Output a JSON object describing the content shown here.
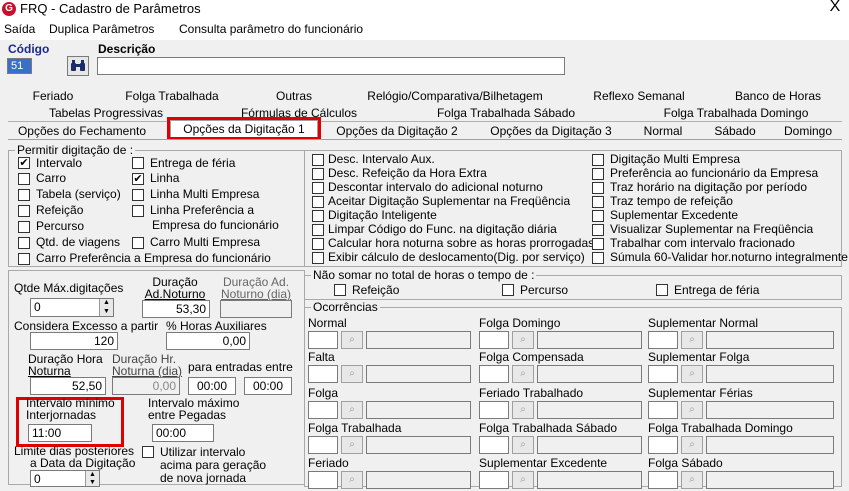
{
  "window": {
    "title": "FRQ - Cadastro de Parâmetros",
    "close_glyph": "X"
  },
  "menu": {
    "items": [
      "Saída",
      "Duplica Parâmetros",
      "Consulta parâmetro do funcionário"
    ]
  },
  "header": {
    "codigo_label": "Código",
    "codigo_value": "51",
    "descricao_label": "Descrição",
    "descricao_value": ""
  },
  "tabs": {
    "row1": [
      "Feriado",
      "Folga Trabalhada",
      "Outras",
      "Relógio/Comparativa/Bilhetagem",
      "Reflexo Semanal",
      "Banco de Horas"
    ],
    "row2": [
      "Tabelas Progressivas",
      "Fórmulas de Cálculos",
      "Folga Trabalhada Sábado",
      "Folga Trabalhada Domingo"
    ],
    "row3": [
      "Opções do Fechamento",
      "Opções da Digitação 1",
      "Opções da Digitação 2",
      "Opções da Digitação 3",
      "Normal",
      "Sábado",
      "Domingo"
    ],
    "active": "Opções da Digitação 1"
  },
  "permitir": {
    "title": "Permitir digitação de :",
    "left": [
      {
        "label": "Intervalo",
        "checked": true
      },
      {
        "label": "Carro",
        "checked": false
      },
      {
        "label": "Tabela (serviço)",
        "checked": false
      },
      {
        "label": "Refeição",
        "checked": false
      },
      {
        "label": "Percurso",
        "checked": false
      },
      {
        "label": "Qtd. de viagens",
        "checked": false
      },
      {
        "label": "Carro Preferência a Empresa do funcionário",
        "checked": false
      }
    ],
    "right": [
      {
        "label": "Entrega de féria",
        "checked": false
      },
      {
        "label": "Linha",
        "checked": true
      },
      {
        "label": "Linha Multi Empresa",
        "checked": false
      },
      {
        "label": "Linha Preferência a",
        "checked": false
      },
      {
        "label": "Empresa do funcionário"
      },
      {
        "label": "Carro Multi Empresa",
        "checked": false
      }
    ]
  },
  "options_mid": [
    "Desc. Intervalo Aux.",
    "Desc. Refeição da Hora Extra",
    "Descontar intervalo do adicional noturno",
    "Aceitar Digitação Suplementar na Freqüência",
    "Digitação Inteligente",
    "Limpar Código do Func. na digitação diária",
    "Calcular hora noturna sobre as horas prorrogadas",
    "Exibir cálculo de deslocamento(Dig. por serviço)"
  ],
  "options_right": [
    "Digitação Multi Empresa",
    "Preferência ao funcionário da Empresa",
    "Traz horário na digitação por período",
    "Traz tempo de refeição",
    "Suplementar Excedente",
    "Visualizar Suplementar na Freqüência",
    "Trabalhar com intervalo fracionado",
    "Súmula 60-Validar hor.noturno integralmente"
  ],
  "fields": {
    "qtde_max_label": "Qtde Máx.digitações",
    "qtde_max_value": "0",
    "dur_ad_not_label1": "Duração",
    "dur_ad_not_label2": "Ad.Noturno",
    "dur_ad_not_value": "53,30",
    "dur_ad_dia_label1": "Duração Ad.",
    "dur_ad_dia_label2": "Noturno (dia)",
    "considera_label": "Considera Excesso a partir",
    "considera_value": "120",
    "perc_aux_label": "% Horas Auxiliares",
    "perc_aux_value": "0,00",
    "dur_hora_not_label1": "Duração Hora",
    "dur_hora_not_label2": "Noturna",
    "dur_hora_not_value": "52,50",
    "dur_hr_dia_label1": "Duração Hr.",
    "dur_hr_dia_label2": "Noturna (dia)",
    "dur_hr_dia_value": "0,00",
    "entradas_label": "para entradas entre",
    "entradas_from": "00:00",
    "entradas_to": "00:00",
    "int_min_label1": "Intervalo mínimo",
    "int_min_label2": "Interjornadas",
    "int_min_value": "11:00",
    "int_max_label1": "Intervalo máximo",
    "int_max_label2": "entre Pegadas",
    "int_max_value": "00:00",
    "limite_label1": "Limite dias posteriores",
    "limite_label2": "a Data da Digitação",
    "limite_value": "0",
    "utilizar_label1": "Utilizar intervalo",
    "utilizar_label2": "acima para geração",
    "utilizar_label3": "de nova jornada"
  },
  "nao_somar": {
    "title": "Não somar no total de horas o tempo de :",
    "items": [
      "Refeição",
      "Percurso",
      "Entrega de féria"
    ]
  },
  "ocorrencias": {
    "title": "Ocorrências",
    "cells": [
      "Normal",
      "Folga Domingo",
      "Suplementar Normal",
      "Falta",
      "Folga Compensada",
      "Suplementar Folga",
      "Folga",
      "Feriado Trabalhado",
      "Suplementar Férias",
      "Folga Trabalhada",
      "Folga Trabalhada Sábado",
      "Folga Trabalhada Domingo",
      "Feriado",
      "Suplementar Excedente",
      "Folga Sábado"
    ]
  }
}
